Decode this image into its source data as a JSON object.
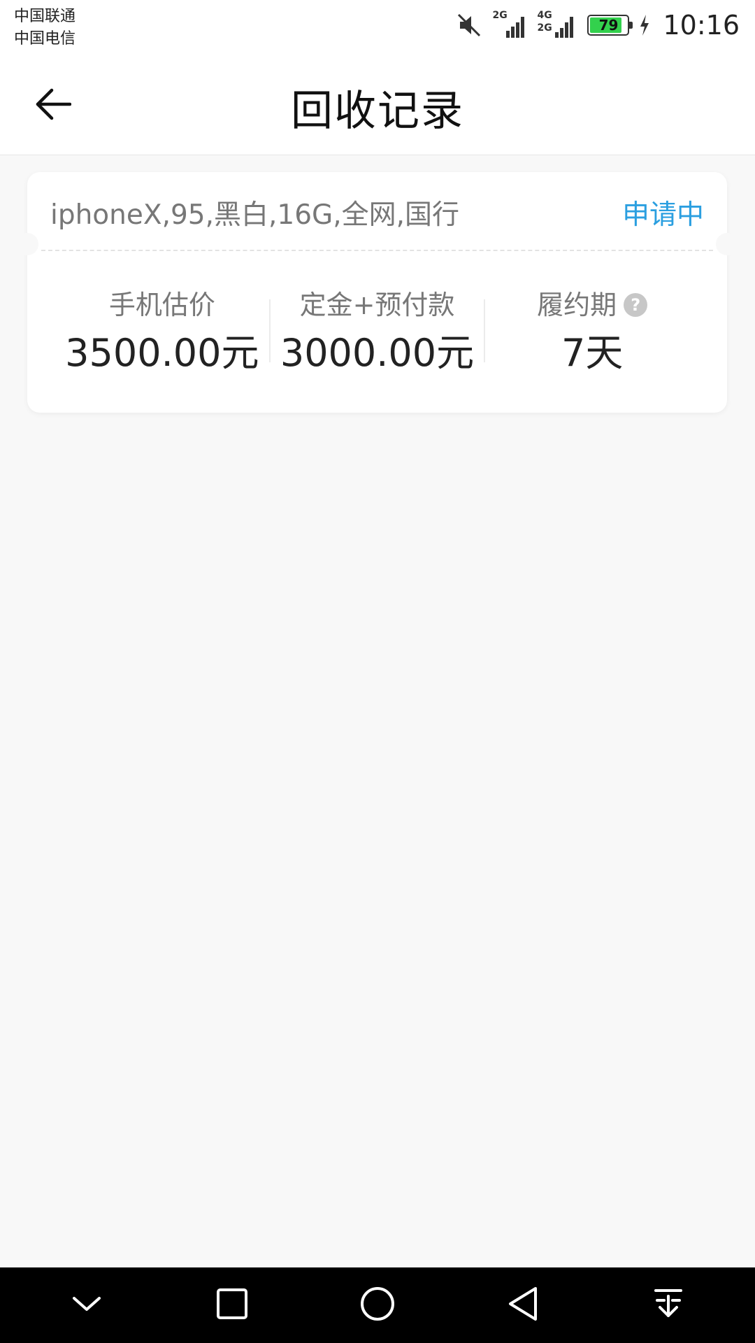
{
  "status_bar": {
    "carrier_1": "中国联通",
    "carrier_2": "中国电信",
    "network_1": "2G",
    "network_2": "4G",
    "network_3": "2G",
    "battery_level": "79",
    "time": "10:16"
  },
  "header": {
    "title": "回收记录",
    "back_icon": "arrow-left-icon"
  },
  "record": {
    "device_desc": "iphoneX,95,黑白,16G,全网,国行",
    "status": "申请中",
    "status_color": "#2b9fe0",
    "stats": [
      {
        "label": "手机估价",
        "value": "3500.00元"
      },
      {
        "label": "定金+预付款",
        "value": "3000.00元"
      },
      {
        "label": "履约期",
        "value": "7天",
        "help_icon": "?"
      }
    ]
  },
  "nav_bar": {
    "icons": [
      "chevron-down-icon",
      "square-icon",
      "circle-icon",
      "triangle-back-icon",
      "download-tray-icon"
    ]
  }
}
